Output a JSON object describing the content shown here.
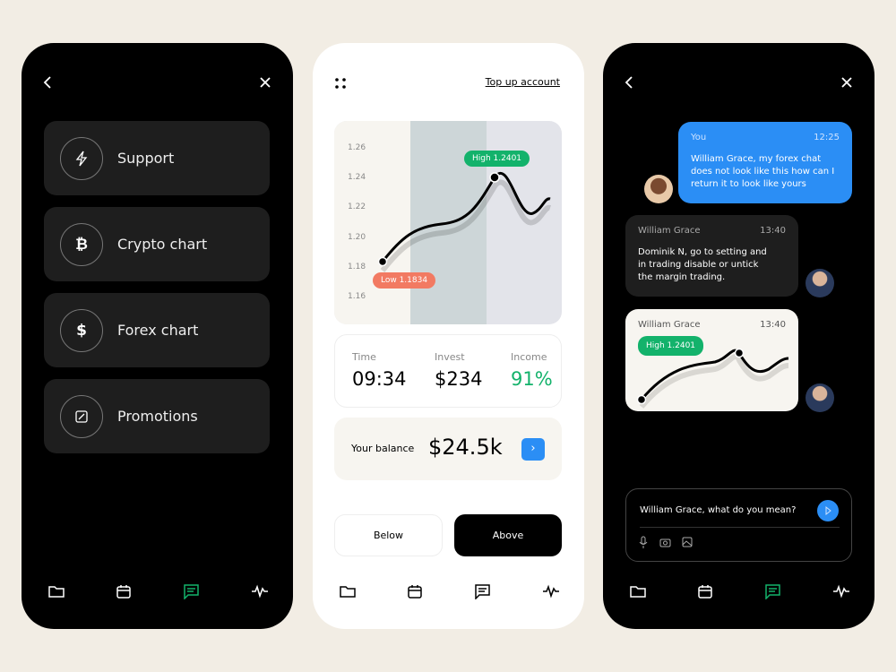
{
  "left_screen": {
    "menu": [
      {
        "label": "Support",
        "icon": "lightning-icon"
      },
      {
        "label": "Crypto chart",
        "icon": "bitcoin-icon"
      },
      {
        "label": "Forex chart",
        "icon": "dollar-icon"
      },
      {
        "label": "Promotions",
        "icon": "percent-tag-icon"
      }
    ]
  },
  "middle_screen": {
    "top_up_link": "Top up account",
    "chart": {
      "y_ticks": [
        "1.26",
        "1.24",
        "1.22",
        "1.20",
        "1.18",
        "1.16"
      ],
      "high_label": "High 1.2401",
      "low_label": "Low 1.1834"
    },
    "stats": [
      {
        "label": "Time",
        "value": "09:34"
      },
      {
        "label": "Invest",
        "value": "$234"
      },
      {
        "label": "Income",
        "value": "91%"
      }
    ],
    "balance": {
      "label": "Your balance",
      "value": "$24.5k",
      "arrow": "›"
    },
    "buttons": {
      "below": "Below",
      "above": "Above"
    }
  },
  "right_screen": {
    "messages": [
      {
        "sender": "You",
        "time": "12:25",
        "text": "William Grace, my forex chat does not look like this how can I return it to look like yours"
      },
      {
        "sender": "William Grace",
        "time": "13:40",
        "text": "Dominik N, go to setting and in trading disable or untick the margin trading."
      },
      {
        "sender": "William Grace",
        "time": "13:40",
        "chart_label": "High 1.2401"
      }
    ],
    "composer": {
      "value": "William Grace, what do you mean?"
    }
  },
  "colors": {
    "accent_blue": "#2b8ef5",
    "green": "#13b26b",
    "low_red": "#f27a62",
    "active_nav": "#13b26b"
  }
}
